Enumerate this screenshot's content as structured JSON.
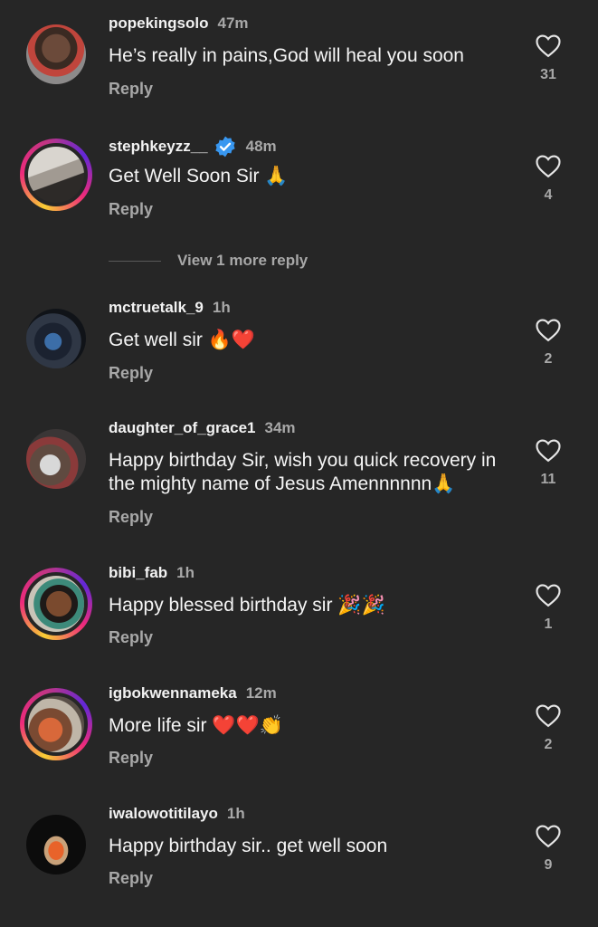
{
  "comments": [
    {
      "username": "popekingsolo",
      "time": "47m",
      "text": "He’s really in pains,God will heal you soon",
      "reply": "Reply",
      "likes": "31",
      "story_ring": false,
      "verified": false
    },
    {
      "username": "stephkeyzz__",
      "time": "48m",
      "text": "Get Well Soon Sir 🙏",
      "reply": "Reply",
      "likes": "4",
      "story_ring": true,
      "verified": true
    },
    {
      "username": "mctruetalk_9",
      "time": "1h",
      "text": "Get well sir 🔥❤️",
      "reply": "Reply",
      "likes": "2",
      "story_ring": false,
      "verified": false
    },
    {
      "username": "daughter_of_grace1",
      "time": "34m",
      "text": "Happy birthday Sir, wish you quick recovery in the mighty name of Jesus Amennnnnn🙏",
      "reply": "Reply",
      "likes": "11",
      "story_ring": false,
      "verified": false
    },
    {
      "username": "bibi_fab",
      "time": "1h",
      "text": "Happy blessed birthday sir 🎉🎉",
      "reply": "Reply",
      "likes": "1",
      "story_ring": true,
      "verified": false
    },
    {
      "username": "igbokwennameka",
      "time": "12m",
      "text": "More life sir ❤️❤️👏",
      "reply": "Reply",
      "likes": "2",
      "story_ring": true,
      "verified": false
    },
    {
      "username": "iwalowotitilayo",
      "time": "1h",
      "text": "Happy birthday sir.. get well soon",
      "reply": "Reply",
      "likes": "9",
      "story_ring": false,
      "verified": false
    }
  ],
  "view_more_replies": "View 1 more reply",
  "icons": {
    "like": "heart-outline-icon",
    "verified": "verified-badge-icon"
  },
  "colors": {
    "background": "#262626",
    "secondary_text": "#a8a8a8",
    "verified": "#3897f0"
  }
}
